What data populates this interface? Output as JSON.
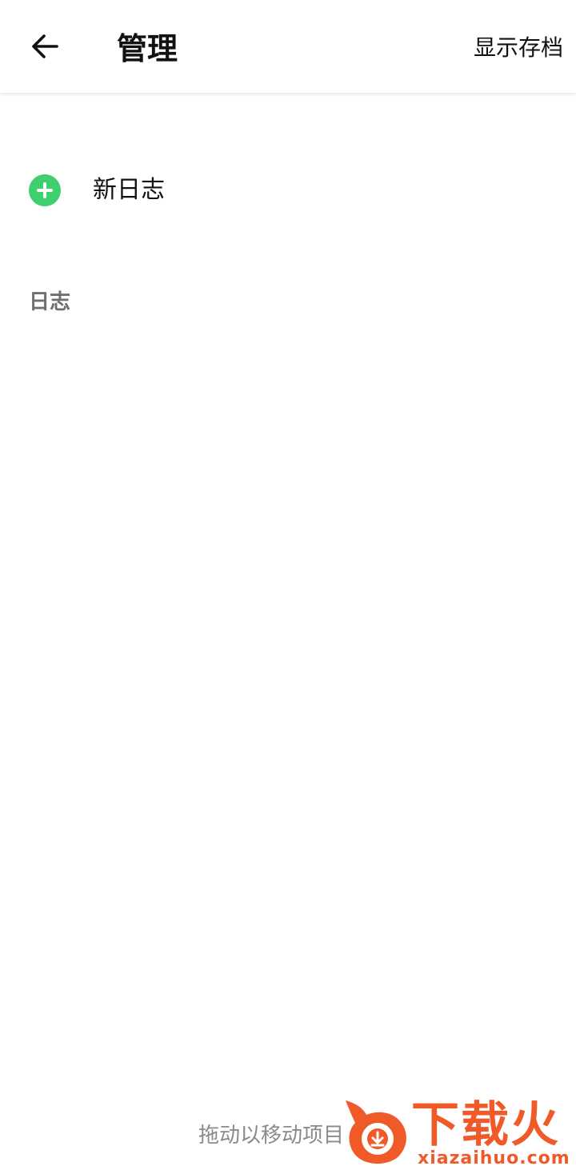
{
  "header": {
    "title": "管理",
    "back_icon": "arrow-left-icon",
    "archive_label": "显示存档"
  },
  "actions": {
    "new_log_label": "新日志",
    "new_log_icon": "plus-circle-icon",
    "accent_color": "#3ecf6e"
  },
  "section": {
    "title": "日志"
  },
  "footer": {
    "hint": "拖动以移动项目"
  },
  "watermark": {
    "brand_text": "下载火",
    "domain_text": "xiazaihuo.com",
    "color": "#f05a28"
  }
}
